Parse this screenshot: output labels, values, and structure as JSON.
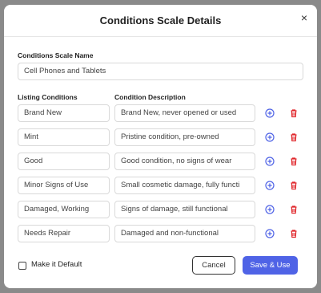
{
  "dialog": {
    "title": "Conditions Scale Details",
    "close_glyph": "×"
  },
  "form": {
    "name_label": "Conditions Scale Name",
    "name_value": "Cell Phones and Tablets",
    "listing_label": "Listing Conditions",
    "description_label": "Condition Description",
    "rows": [
      {
        "condition": "Brand New",
        "description": "Brand New, never opened or used"
      },
      {
        "condition": "Mint",
        "description": "Pristine condition, pre-owned"
      },
      {
        "condition": "Good",
        "description": "Good condition, no signs of wear"
      },
      {
        "condition": "Minor Signs of Use",
        "description": "Small cosmetic damage, fully functi"
      },
      {
        "condition": "Damaged, Working",
        "description": "Signs of damage, still functional"
      },
      {
        "condition": "Needs Repair",
        "description": "Damaged and non-functional"
      }
    ],
    "default_label": "Make it Default"
  },
  "buttons": {
    "cancel": "Cancel",
    "save": "Save & Use"
  },
  "icons": {
    "add": "plus-circle-icon",
    "delete": "trash-icon"
  },
  "colors": {
    "accent": "#4f63e6",
    "delete": "#e0262b"
  }
}
